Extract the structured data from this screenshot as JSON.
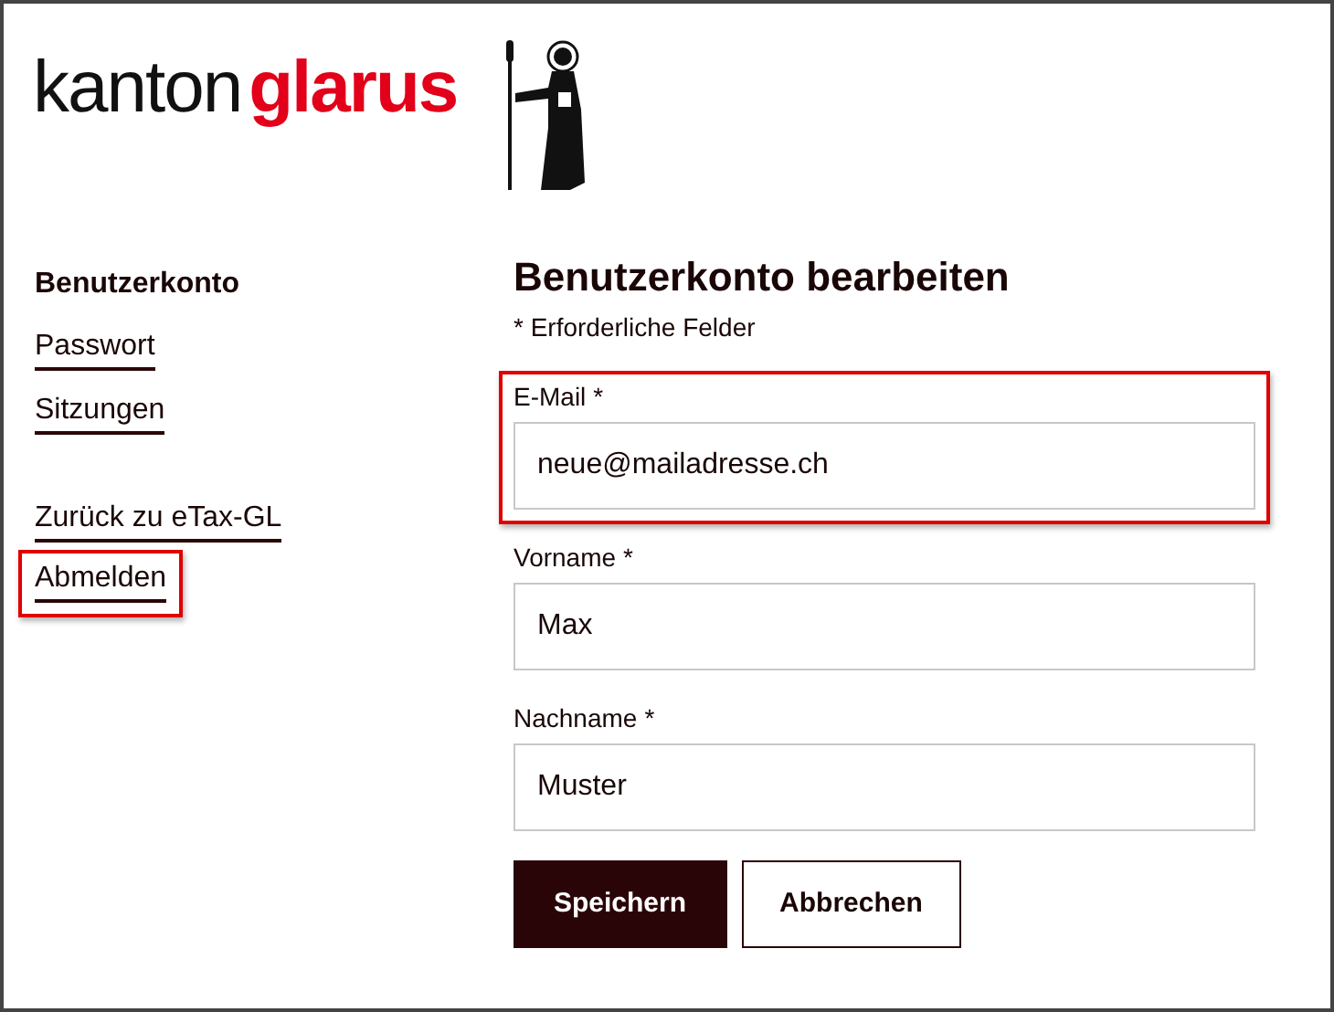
{
  "logo": {
    "part_1": "kanton",
    "part_2": "glarus"
  },
  "sidebar": {
    "heading": "Benutzerkonto",
    "groups": [
      {
        "items": [
          {
            "label": "Passwort",
            "highlighted": false
          },
          {
            "label": "Sitzungen",
            "highlighted": false
          }
        ]
      },
      {
        "items": [
          {
            "label": "Zurück zu eTax-GL",
            "highlighted": false
          },
          {
            "label": "Abmelden",
            "highlighted": true
          }
        ]
      }
    ]
  },
  "form": {
    "title": "Benutzerkonto bearbeiten",
    "required_note": "* Erforderliche Felder",
    "fields": [
      {
        "label": "E-Mail",
        "required_mark": "*",
        "value": "neue@mailadresse.ch",
        "highlighted": true
      },
      {
        "label": "Vorname",
        "required_mark": "*",
        "value": "Max",
        "highlighted": false
      },
      {
        "label": "Nachname",
        "required_mark": "*",
        "value": "Muster",
        "highlighted": false
      }
    ],
    "buttons": [
      {
        "label": "Speichern",
        "kind": "primary"
      },
      {
        "label": "Abbrechen",
        "kind": "secondary"
      }
    ]
  }
}
